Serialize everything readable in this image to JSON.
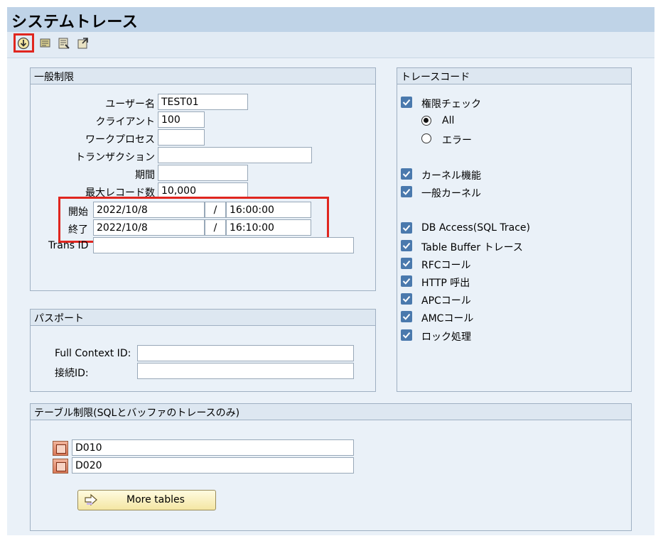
{
  "title": "システムトレース",
  "toolbar": {
    "items": [
      "execute-icon",
      "filter-icon",
      "copy-icon",
      "export-icon"
    ]
  },
  "general": {
    "title": "一般制限",
    "user_label": "ユーザー名",
    "user_value": "TEST01",
    "client_label": "クライアント",
    "client_value": "100",
    "wp_label": "ワークプロセス",
    "wp_value": "",
    "tx_label": "トランザクション",
    "tx_value": "",
    "period_label": "期間",
    "period_value": "",
    "maxrec_label": "最大レコード数",
    "maxrec_value": "10,000",
    "start_label": "開始",
    "start_date": "2022/10/8",
    "start_time": "16:00:00",
    "end_label": "終了",
    "end_date": "2022/10/8",
    "end_time": "16:10:00",
    "slash": "/",
    "transid_label": "Trans ID",
    "transid_value": ""
  },
  "passport": {
    "title": "パスポート",
    "fullctx_label": "Full Context ID:",
    "fullctx_value": "",
    "conn_label": "接続ID:",
    "conn_value": ""
  },
  "trace": {
    "title": "トレースコード",
    "auth": "権限チェック",
    "radio_all": "All",
    "radio_error": "エラー",
    "kernel": "カーネル機能",
    "general_kernel": "一般カーネル",
    "db": "DB Access(SQL Trace)",
    "table_buffer": "Table Buffer トレース",
    "rfc": "RFCコール",
    "http": "HTTP 呼出",
    "apc": "APCコール",
    "amc": "AMCコール",
    "lock": "ロック処理"
  },
  "tables": {
    "title": "テーブル制限(SQLとバッファのトレースのみ)",
    "row1": "D010",
    "row2": "D020",
    "more_label": "More tables"
  }
}
